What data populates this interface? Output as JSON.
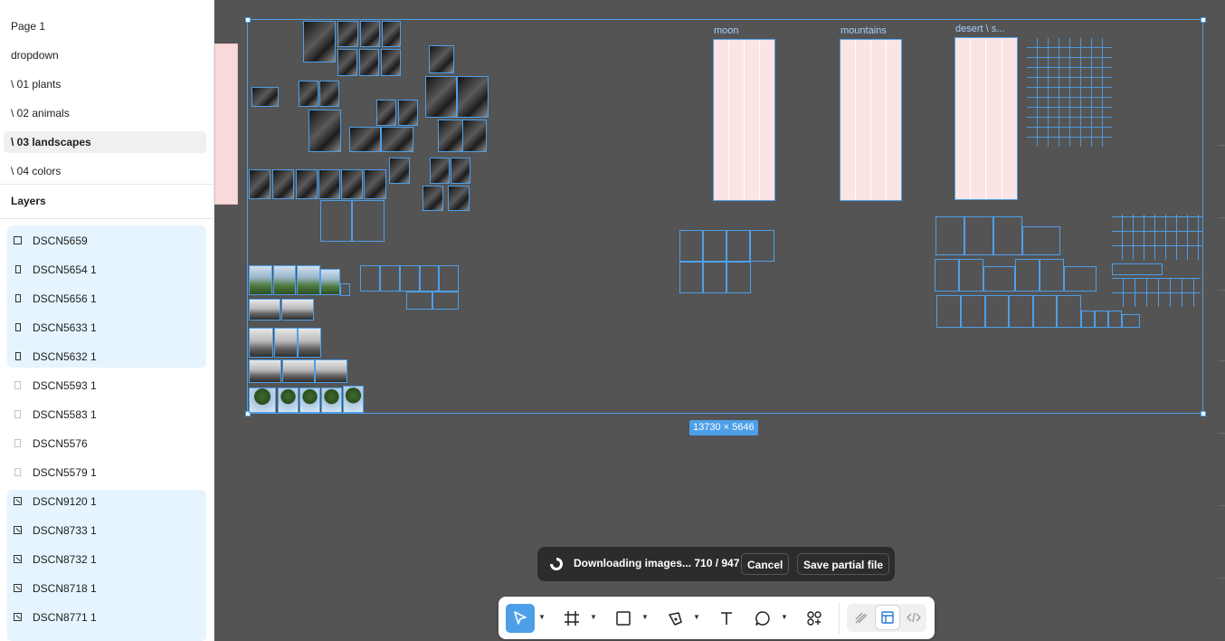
{
  "pages": [
    {
      "label": "Page 1",
      "active": false
    },
    {
      "label": "dropdown",
      "active": false
    },
    {
      "label": "\\ 01 plants",
      "active": false
    },
    {
      "label": "\\ 02 animals",
      "active": false
    },
    {
      "label": "\\ 03 landscapes",
      "active": true
    },
    {
      "label": "\\ 04 colors",
      "active": false
    }
  ],
  "layers_title": "Layers",
  "layers": [
    {
      "label": "DSCN5659",
      "icon": "frame-icon",
      "selected": true
    },
    {
      "label": "DSCN5654 1",
      "icon": "portrait-frame-icon",
      "selected": true
    },
    {
      "label": "DSCN5656 1",
      "icon": "portrait-frame-icon",
      "selected": true
    },
    {
      "label": "DSCN5633 1",
      "icon": "portrait-frame-icon",
      "selected": true
    },
    {
      "label": "DSCN5632 1",
      "icon": "portrait-frame-icon",
      "selected": true
    },
    {
      "label": "DSCN5593 1",
      "icon": "faint-frame-icon",
      "selected": false
    },
    {
      "label": "DSCN5583 1",
      "icon": "faint-frame-icon",
      "selected": false
    },
    {
      "label": "DSCN5576",
      "icon": "faint-frame-icon",
      "selected": false
    },
    {
      "label": "DSCN5579 1",
      "icon": "faint-frame-icon",
      "selected": false
    },
    {
      "label": "DSCN9120 1",
      "icon": "image-icon",
      "selected": true
    },
    {
      "label": "DSCN8733 1",
      "icon": "image-icon",
      "selected": true
    },
    {
      "label": "DSCN8732 1",
      "icon": "image-icon",
      "selected": true
    },
    {
      "label": "DSCN8718 1",
      "icon": "image-icon",
      "selected": true
    },
    {
      "label": "DSCN8771 1",
      "icon": "image-icon",
      "selected": true
    }
  ],
  "canvas": {
    "frame_labels": {
      "moon": "moon",
      "mountains": "mountains",
      "desert": "desert \\ s..."
    },
    "size_badge": "13730 × 5646",
    "selection_color": "#4d9fe8"
  },
  "toast": {
    "message": "Downloading images... 710 / 947",
    "cancel_label": "Cancel",
    "save_label": "Save partial file"
  },
  "toolbar": {
    "tools": [
      "move-tool",
      "frame-tool",
      "shape-tool",
      "pen-tool",
      "text-tool",
      "comment-tool",
      "actions-tool"
    ],
    "modes": [
      "draw-mode",
      "design-mode",
      "dev-mode"
    ],
    "active_tool": "move-tool",
    "active_mode": "design-mode"
  },
  "colors": {
    "accent": "#4d9fe8",
    "canvas_bg": "#545454",
    "selected_layer_bg": "#e5f4ff",
    "toast_bg": "#2c2c2c"
  }
}
